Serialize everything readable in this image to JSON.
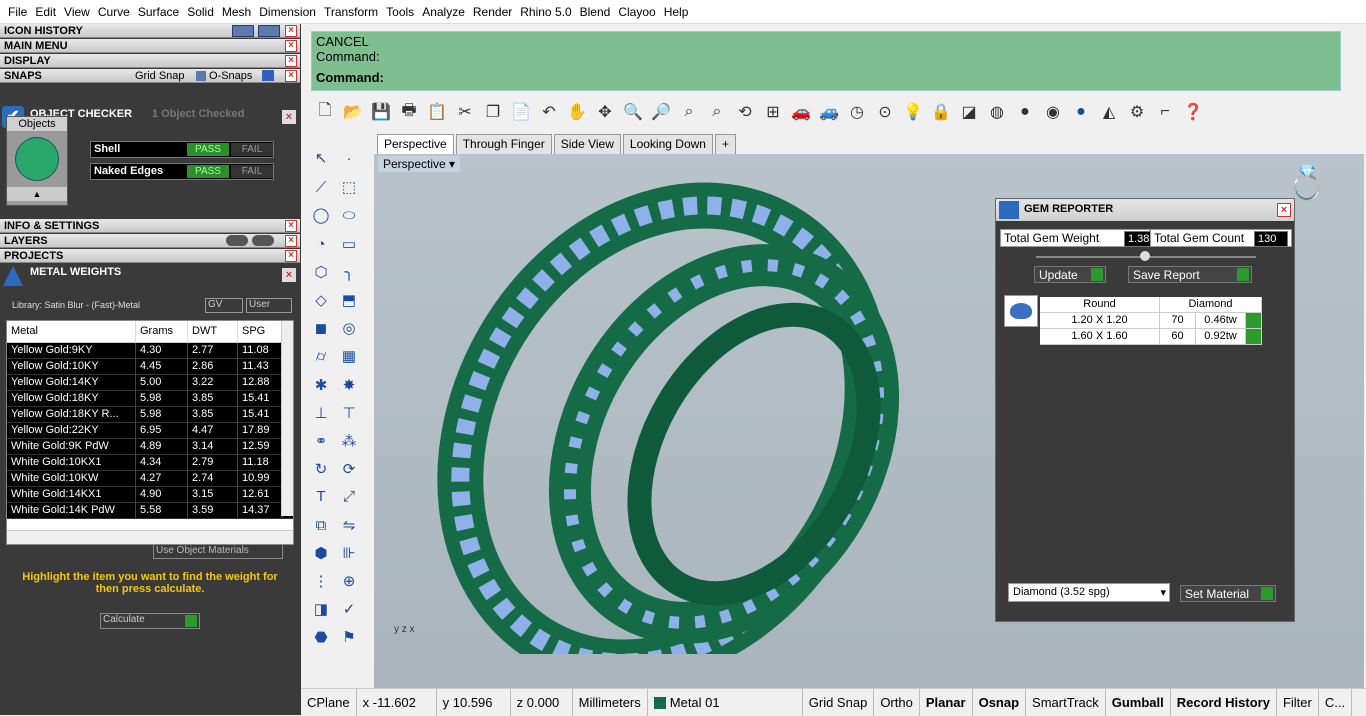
{
  "menu": [
    "File",
    "Edit",
    "View",
    "Curve",
    "Surface",
    "Solid",
    "Mesh",
    "Dimension",
    "Transform",
    "Tools",
    "Analyze",
    "Render",
    "Rhino 5.0",
    "Blend",
    "Clayoo",
    "Help"
  ],
  "left": {
    "icon_history": "ICON HISTORY",
    "main_menu": "MAIN MENU",
    "display": "DISPLAY",
    "snaps": "SNAPS",
    "grid_snap": "Grid Snap",
    "o_snaps": "O-Snaps",
    "object_checker": "OBJECT CHECKER",
    "object_checked": "1  Object Checked",
    "objects_label": "Objects",
    "checks": [
      {
        "name": "Shell",
        "pass": "PASS",
        "fail": "FAIL"
      },
      {
        "name": "Naked Edges",
        "pass": "PASS",
        "fail": "FAIL"
      }
    ],
    "info": "INFO & SETTINGS",
    "layers": "LAYERS",
    "projects": "PROJECTS",
    "metal_weights": "METAL WEIGHTS",
    "library": "Library: Satin Blur - (Fast)-Metal",
    "gv": "GV",
    "user": "User",
    "cols": [
      "Metal",
      "Grams",
      "DWT",
      "SPG"
    ],
    "rows": [
      [
        "Yellow Gold:9KY",
        "4.30",
        "2.77",
        "11.08"
      ],
      [
        "Yellow Gold:10KY",
        "4.45",
        "2.86",
        "11.43"
      ],
      [
        "Yellow Gold:14KY",
        "5.00",
        "3.22",
        "12.88"
      ],
      [
        "Yellow Gold:18KY",
        "5.98",
        "3.85",
        "15.41"
      ],
      [
        "Yellow Gold:18KY R...",
        "5.98",
        "3.85",
        "15.41"
      ],
      [
        "Yellow Gold:22KY",
        "6.95",
        "4.47",
        "17.89"
      ],
      [
        "White Gold:9K PdW",
        "4.89",
        "3.14",
        "12.59"
      ],
      [
        "White Gold:10KX1",
        "4.34",
        "2.79",
        "11.18"
      ],
      [
        "White Gold:10KW",
        "4.27",
        "2.74",
        "10.99"
      ],
      [
        "White Gold:14KX1",
        "4.90",
        "3.15",
        "12.61"
      ],
      [
        "White Gold:14K PdW",
        "5.58",
        "3.59",
        "14.37"
      ]
    ],
    "use_object_materials": "Use Object Materials",
    "hint": "Highlight the item you want to find the weight for then press calculate.",
    "calculate": "Calculate"
  },
  "cmd": {
    "line1": "CANCEL",
    "line2": "Command:",
    "line3": "Command:"
  },
  "tabs": [
    "Perspective",
    "Through Finger",
    "Side View",
    "Looking Down",
    "+"
  ],
  "viewport_label": "Perspective",
  "gem": {
    "title": "GEM REPORTER",
    "tgw_label": "Total Gem Weight",
    "tgw": "1.38",
    "tgc_label": "Total Gem Count",
    "tgc": "130",
    "update": "Update",
    "save": "Save Report",
    "table_head": [
      "Round",
      "Diamond"
    ],
    "table_rows": [
      [
        "1.20 X 1.20",
        "70",
        "0.46tw"
      ],
      [
        "1.60 X 1.60",
        "60",
        "0.92tw"
      ]
    ],
    "material": "Diamond    (3.52 spg)",
    "set_material": "Set Material"
  },
  "status": {
    "cplane": "CPlane",
    "x": "x -11.602",
    "y": "y 10.596",
    "z": "z 0.000",
    "units": "Millimeters",
    "layer": "Metal 01",
    "toggles": [
      "Grid Snap",
      "Ortho",
      "Planar",
      "Osnap",
      "SmartTrack",
      "Gumball",
      "Record History",
      "Filter",
      "C..."
    ]
  },
  "colors": {
    "accent": "#7fbf8f",
    "ring": "#146b46",
    "gem": "#8fb0e8",
    "pass": "#2c8f2c"
  }
}
